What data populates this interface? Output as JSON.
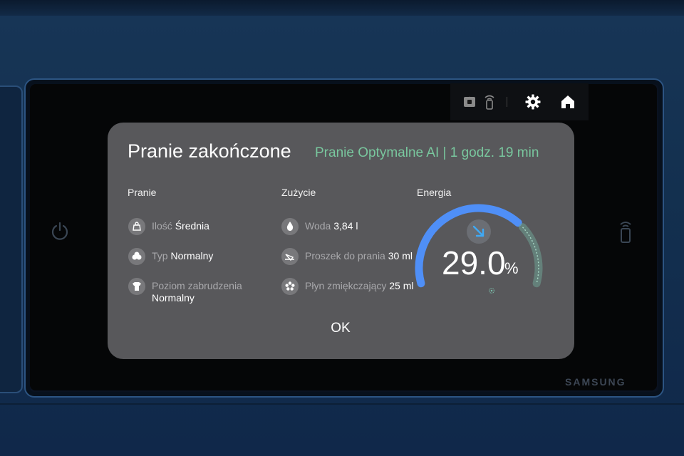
{
  "dialog": {
    "title": "Pranie zakończone",
    "subtitle": "Pranie Optymalne AI | 1 godz. 19 min",
    "ok_label": "OK"
  },
  "pranie": {
    "heading": "Pranie",
    "items": [
      {
        "label": "Ilość",
        "value": "Średnia",
        "icon": "scale-icon"
      },
      {
        "label": "Typ",
        "value": "Normalny",
        "icon": "fabric-type-icon"
      },
      {
        "label": "Poziom zabrudzenia",
        "value": "Normalny",
        "icon": "soil-level-icon"
      }
    ]
  },
  "zuzycie": {
    "heading": "Zużycie",
    "items": [
      {
        "label": "Woda",
        "value": "3,84 l",
        "icon": "water-drop-icon"
      },
      {
        "label": "Proszek do prania",
        "value": "30 ml",
        "icon": "detergent-icon"
      },
      {
        "label": "Płyn zmiękczający",
        "value": "25 ml",
        "icon": "softener-icon"
      }
    ]
  },
  "energia": {
    "heading": "Energia",
    "value": "29.0",
    "unit": "%",
    "saving_percent": 29.0,
    "colors": {
      "arc_main": "#4f8ff7",
      "arc_saved": "#6fa393",
      "arrow": "#3fa9f5"
    }
  },
  "device": {
    "brand": "SAMSUNG"
  },
  "colors": {
    "dialog_bg": "#58585b",
    "subtitle": "#79c79e",
    "panel": "#173556"
  }
}
